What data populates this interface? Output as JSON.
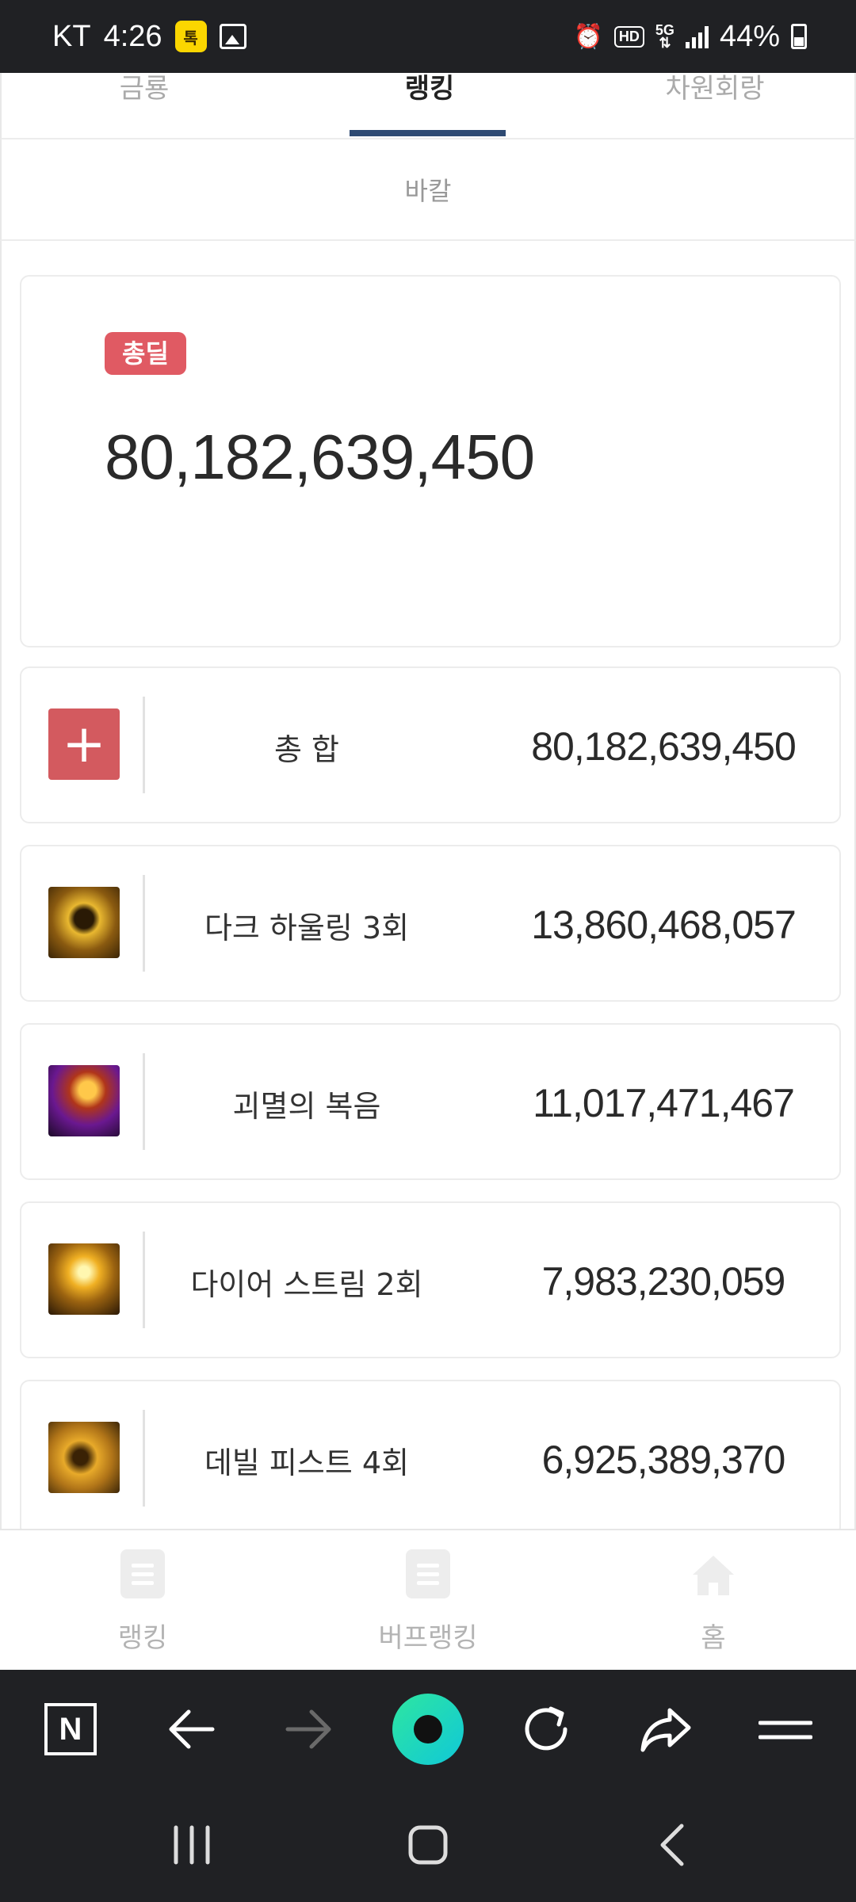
{
  "status_bar": {
    "carrier": "KT",
    "time": "4:26",
    "battery": "44%"
  },
  "tabs": [
    {
      "label": "금룡"
    },
    {
      "label": "랭킹"
    },
    {
      "label": "차원회랑"
    }
  ],
  "subtab": {
    "label": "바칼"
  },
  "total": {
    "badge": "총딜",
    "value": "80,182,639,450"
  },
  "rows": [
    {
      "name": "총 합",
      "value": "80,182,639,450",
      "icon": "plus-icon"
    },
    {
      "name": "다크 하울링 3회",
      "value": "13,860,468,057",
      "icon": "dark-howling-skill-icon"
    },
    {
      "name": "괴멸의 복음",
      "value": "11,017,471,467",
      "icon": "gospel-of-destruction-skill-icon"
    },
    {
      "name": "다이어 스트림 2회",
      "value": "7,983,230,059",
      "icon": "dire-stream-skill-icon"
    },
    {
      "name": "데빌 피스트 4회",
      "value": "6,925,389,370",
      "icon": "devil-fist-skill-icon"
    }
  ],
  "bottom_nav": [
    {
      "label": "랭킹",
      "icon": "list-icon"
    },
    {
      "label": "버프랭킹",
      "icon": "list-icon"
    },
    {
      "label": "홈",
      "icon": "home-icon"
    }
  ],
  "browser_toolbar": [
    "naver-n-icon",
    "back-arrow-icon",
    "forward-arrow-icon",
    "green-dot-icon",
    "refresh-icon",
    "share-icon",
    "menu-icon"
  ],
  "colors": {
    "badge": "#e05a63",
    "tab_underline": "#2e4a73",
    "plus_box": "#d35a5f"
  }
}
